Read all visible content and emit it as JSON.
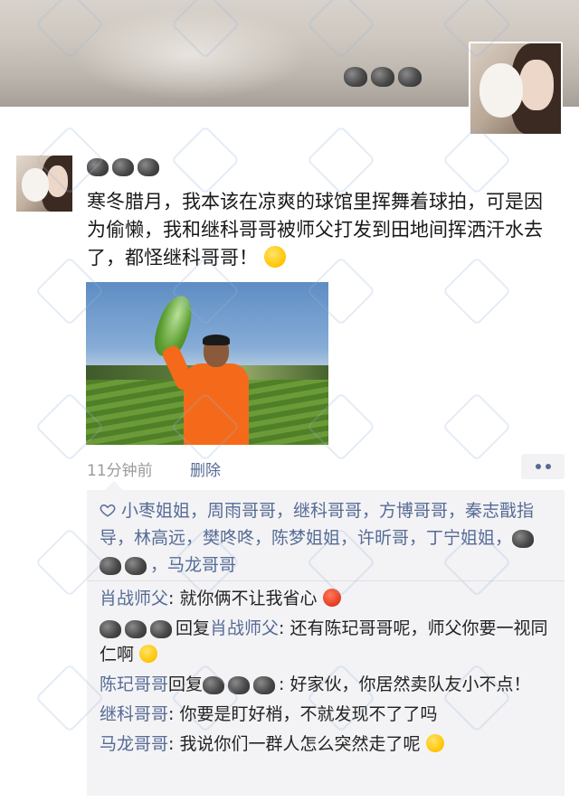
{
  "profile": {
    "cover_name_icon": "rock-emoji-x3",
    "avatar_icon": "avatar-girl-with-dog"
  },
  "post": {
    "author_icon": "rock-emoji-x3",
    "text": "寒冬腊月，我本该在凉爽的球馆里挥舞着球拍，可是因为偷懒，我和继科哥哥被师父打发到田地间挥洒汗水去了，都怪继科哥哥！",
    "text_emoji": "angry-face-emoji",
    "photo_icon": "man-holding-vegetable-in-field",
    "time": "11分钟前",
    "delete_label": "删除",
    "more_icon": "more-dots-icon"
  },
  "likes": {
    "icon": "heart-outline-icon",
    "names_line": "小枣姐姐，周雨哥哥，继科哥哥，方博哥哥，秦志戬指导，林高远，樊咚咚，陈梦姐姐，许昕哥，丁宁姐姐，",
    "tail_name": "，马龙哥哥"
  },
  "comments": [
    {
      "author": "肖战师父",
      "sep": ": ",
      "text": "就你俩不让我省心",
      "emoji": "angry-red-face-emoji"
    },
    {
      "author_icon": "rock-emoji-x3",
      "reply_word": "回复",
      "reply_to": "肖战师父",
      "sep": ": ",
      "text": "还有陈玘哥哥呢，师父你要一视同仁啊",
      "emoji": "crying-face-emoji"
    },
    {
      "author": "陈玘哥哥",
      "reply_word": "回复",
      "reply_to_icon": "rock-emoji-x3",
      "sep": ": ",
      "text": "好家伙，你居然卖队友小不点！"
    },
    {
      "author": "继科哥哥",
      "sep": ": ",
      "text": "你要是盯好梢，不就发现不了了吗"
    },
    {
      "author": "马龙哥哥",
      "sep": ": ",
      "text": "我说你们一群人怎么突然走了呢",
      "emoji": "laughing-crying-emoji"
    }
  ],
  "colors": {
    "link_blue": "#576b95",
    "comment_bg": "#f3f3f5",
    "meta_gray": "#9a9a9a"
  }
}
